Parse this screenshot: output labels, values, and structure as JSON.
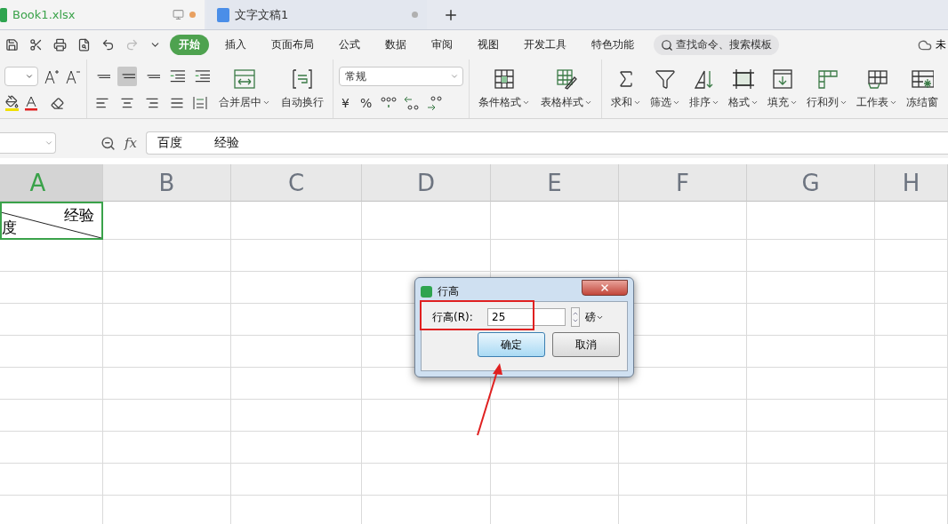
{
  "tabs": [
    {
      "label": "Book1.xlsx",
      "kind": "sheet",
      "selected": true
    },
    {
      "label": "文字文稿1",
      "kind": "writer",
      "selected": false
    }
  ],
  "menu": [
    {
      "label": "开始",
      "selected": true
    },
    {
      "label": "插入",
      "selected": false
    },
    {
      "label": "页面布局",
      "selected": false
    },
    {
      "label": "公式",
      "selected": false
    },
    {
      "label": "数据",
      "selected": false
    },
    {
      "label": "审阅",
      "selected": false
    },
    {
      "label": "视图",
      "selected": false
    },
    {
      "label": "开发工具",
      "selected": false
    },
    {
      "label": "特色功能",
      "selected": false
    }
  ],
  "search": {
    "placeholder": "查找命令、搜索模板"
  },
  "cloud_status": "未",
  "align_buttons": [
    {
      "kind": "top",
      "selected": false
    },
    {
      "kind": "middle",
      "selected": true
    },
    {
      "kind": "bottom",
      "selected": false
    },
    {
      "kind": "outdent",
      "selected": false
    },
    {
      "kind": "indent",
      "selected": false
    }
  ],
  "number_format": "常规",
  "number_symbols": [
    "¥",
    "%"
  ],
  "ribbon_buttons": [
    {
      "label": "合并居中",
      "kind": "merge"
    },
    {
      "label": "自动换行",
      "kind": "wrap"
    },
    {
      "label": "条件格式",
      "kind": "cond"
    },
    {
      "label": "表格样式",
      "kind": "style"
    },
    {
      "label": "求和",
      "kind": "sum"
    },
    {
      "label": "筛选",
      "kind": "filter"
    },
    {
      "label": "排序",
      "kind": "sort"
    },
    {
      "label": "格式",
      "kind": "format"
    },
    {
      "label": "填充",
      "kind": "fill"
    },
    {
      "label": "行和列",
      "kind": "rowcol"
    },
    {
      "label": "工作表",
      "kind": "sheet"
    },
    {
      "label": "冻结窗",
      "kind": "freeze"
    }
  ],
  "formula": {
    "fx_label": "fx",
    "value": "百度        经验"
  },
  "columns": [
    {
      "label": "A",
      "selected": true
    },
    {
      "label": "B",
      "selected": false
    },
    {
      "label": "C",
      "selected": false
    },
    {
      "label": "D",
      "selected": false
    },
    {
      "label": "E",
      "selected": false
    },
    {
      "label": "F",
      "selected": false
    },
    {
      "label": "G",
      "selected": false
    },
    {
      "label": "H",
      "selected": false
    }
  ],
  "cell_a1": {
    "top_right": "经验",
    "bottom_left": "度"
  },
  "dialog": {
    "title": "行高",
    "label": "行高(R):",
    "value": "25",
    "unit": "磅",
    "buttons": [
      {
        "label": "确定",
        "kind": "default"
      },
      {
        "label": "取消",
        "kind": "normal"
      }
    ]
  }
}
